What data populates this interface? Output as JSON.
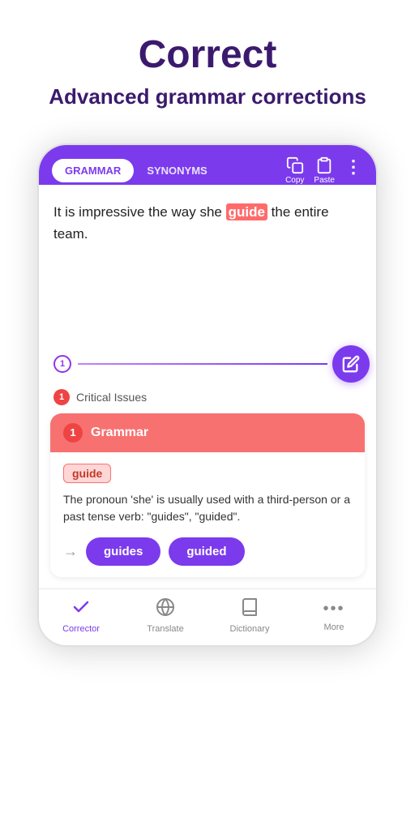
{
  "header": {
    "title": "Correct",
    "subtitle": "Advanced grammar corrections"
  },
  "app": {
    "tabs": [
      {
        "label": "GRAMMAR",
        "active": true
      },
      {
        "label": "SYNONYMS",
        "active": false
      }
    ],
    "actions": {
      "copy_label": "Copy",
      "paste_label": "Paste"
    },
    "text_content": "It is impressive the way she ",
    "error_word": "guide",
    "text_content_after": " the entire team.",
    "issue_count": "1",
    "critical_issues_label": "Critical Issues",
    "grammar_card": {
      "number": "1",
      "category": "Grammar",
      "error_word": "guide",
      "description": "The pronoun 'she' is usually used with a third-person or a past tense verb: \"guides\", \"guided\".",
      "suggestions": [
        "guides",
        "guided"
      ]
    },
    "edit_fab_icon": "✎"
  },
  "bottom_nav": [
    {
      "label": "Corrector",
      "icon": "✓",
      "active": true
    },
    {
      "label": "Translate",
      "icon": "🌐",
      "active": false
    },
    {
      "label": "Dictionary",
      "icon": "📖",
      "active": false
    },
    {
      "label": "More",
      "icon": "•••",
      "active": false
    }
  ]
}
